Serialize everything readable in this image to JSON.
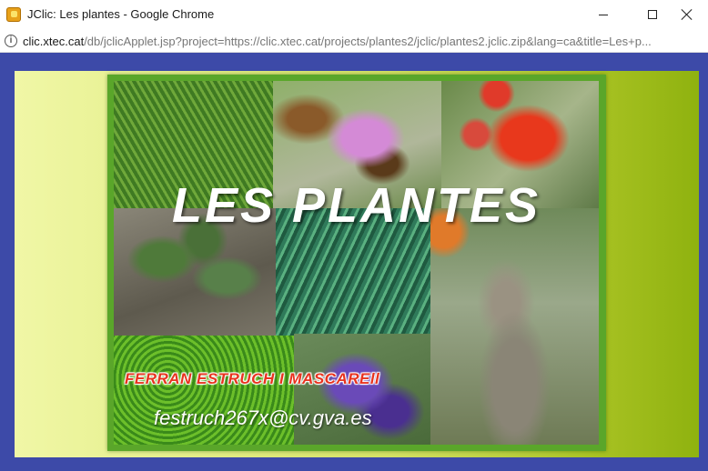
{
  "window": {
    "title": "JClic: Les plantes - Google Chrome",
    "app_icon": "jclic-icon",
    "controls": [
      "minimize-icon",
      "maximize-icon",
      "close-icon"
    ]
  },
  "address_bar": {
    "domain": "clic.xtec.cat",
    "path": "/db/jclicApplet.jsp?project=https://clic.xtec.cat/projects/plantes2/jclic/plantes2.jclic.zip&lang=ca&title=Les+p..."
  },
  "applet": {
    "headline": "LES PLANTES",
    "author": "FERRAN ESTRUCH I MASCAREll",
    "email": "festruch267x@cv.gva.es",
    "colors": {
      "page_background": "#3d4aa8",
      "frame": "#5aa62a",
      "gradient_left": "#f0f7a6",
      "gradient_right": "#8fb20f",
      "author_text": "#e8331f"
    }
  }
}
